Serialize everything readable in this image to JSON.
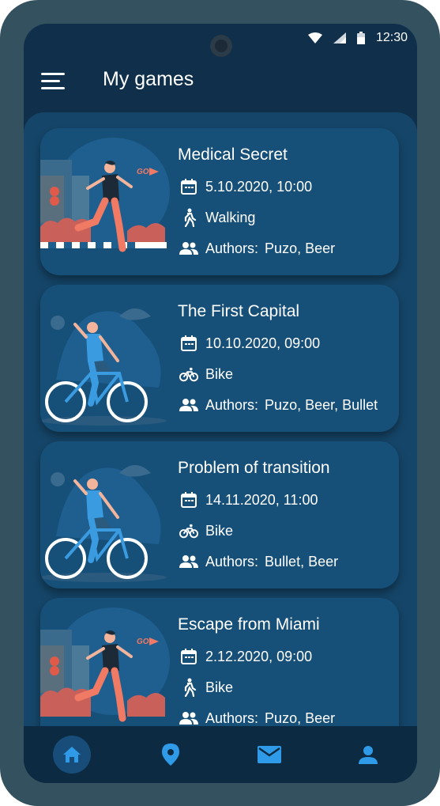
{
  "status_bar": {
    "time": "12:30"
  },
  "header": {
    "title": "My games"
  },
  "games": [
    {
      "title": "Medical Secret",
      "date": "5.10.2020, 10:00",
      "mode": "Walking",
      "mode_icon": "walking-icon",
      "authors_label": "Authors:",
      "authors": "Puzo, Beer"
    },
    {
      "title": "The First Capital",
      "date": "10.10.2020, 09:00",
      "mode": "Bike",
      "mode_icon": "bike-icon",
      "authors_label": "Authors:",
      "authors": "Puzo, Beer, Bullet"
    },
    {
      "title": "Problem of transition",
      "date": "14.11.2020, 11:00",
      "mode": "Bike",
      "mode_icon": "bike-icon",
      "authors_label": "Authors:",
      "authors": "Bullet, Beer"
    },
    {
      "title": "Escape from Miami",
      "date": "2.12.2020, 09:00",
      "mode": "Bike",
      "mode_icon": "walking-icon",
      "authors_label": "Authors:",
      "authors": "Puzo, Beer"
    }
  ],
  "illustrations": {
    "go_sign": "GO"
  },
  "nav": [
    {
      "name": "home",
      "icon": "home-icon",
      "active": true
    },
    {
      "name": "map",
      "icon": "location-pin-icon",
      "active": false
    },
    {
      "name": "messages",
      "icon": "mail-icon",
      "active": false
    },
    {
      "name": "profile",
      "icon": "profile-icon",
      "active": false
    }
  ],
  "colors": {
    "frame": "#34515f",
    "screen": "#0f2f4a",
    "content": "#154568",
    "card": "#164f77",
    "accent": "#2f9be8",
    "runner_pants": "#f07a63",
    "rider_shirt": "#3a9be0"
  }
}
